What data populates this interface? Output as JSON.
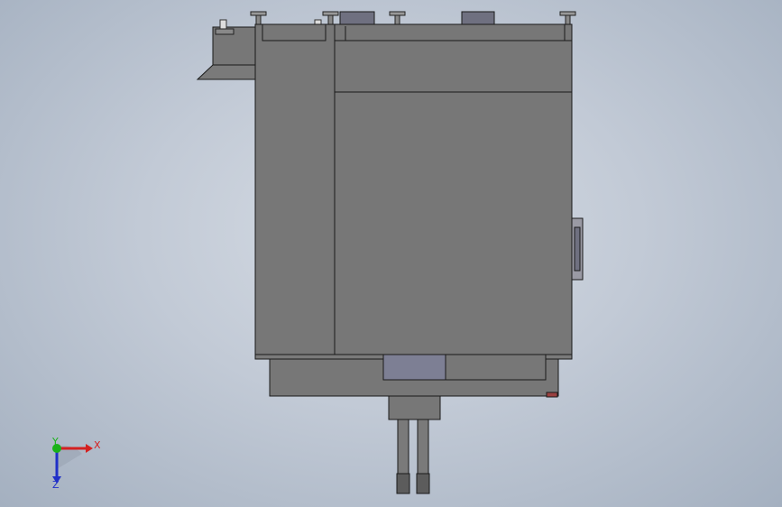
{
  "view": {
    "background_colors": [
      "#d6dce4",
      "#c2cad6",
      "#a4b0c0"
    ],
    "body_color": "#777777",
    "panel_color": "#7d7f94",
    "edge_color": "#1a1a1a"
  },
  "triad": {
    "x_label": "X",
    "y_label": "Y",
    "z_label": "Z",
    "x_color": "#d42020",
    "y_color": "#19b219",
    "z_color": "#2030c8"
  }
}
